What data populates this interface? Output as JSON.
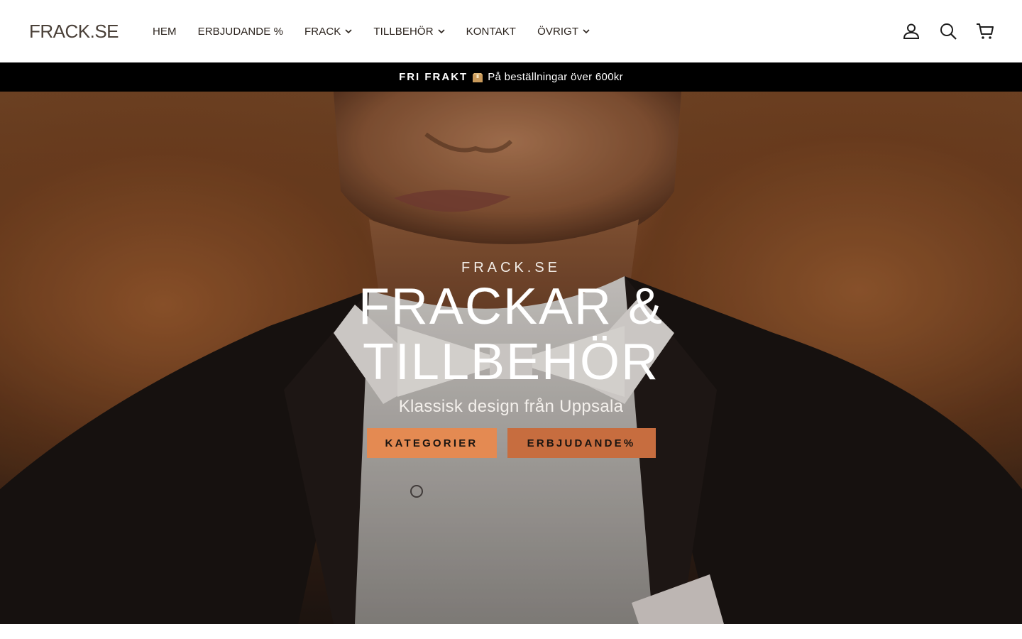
{
  "header": {
    "logo": "FRACK.SE",
    "nav": [
      {
        "label": "HEM",
        "has_dropdown": false
      },
      {
        "label": "ERBJUDANDE %",
        "has_dropdown": false
      },
      {
        "label": "FRACK",
        "has_dropdown": true
      },
      {
        "label": "TILLBEHÖR",
        "has_dropdown": true
      },
      {
        "label": "KONTAKT",
        "has_dropdown": false
      },
      {
        "label": "ÖVRIGT",
        "has_dropdown": true
      }
    ],
    "icons": [
      "account-icon",
      "search-icon",
      "cart-icon"
    ]
  },
  "announcement": {
    "strong": "FRI FRAKT",
    "icon": "package-icon",
    "text": "På beställningar över 600kr"
  },
  "hero": {
    "eyebrow": "FRACK.SE",
    "title_line1": "FRACKAR &",
    "title_line2": "TILLBEHÖR",
    "subtitle": "Klassisk design från Uppsala",
    "buttons": [
      {
        "label": "KATEGORIER"
      },
      {
        "label": "ERBJUDANDE%"
      }
    ]
  },
  "colors": {
    "announcement_bg": "#000000",
    "primary_button": "#e48a52",
    "secondary_button": "#c76d3f",
    "logo": "#4a4038"
  }
}
